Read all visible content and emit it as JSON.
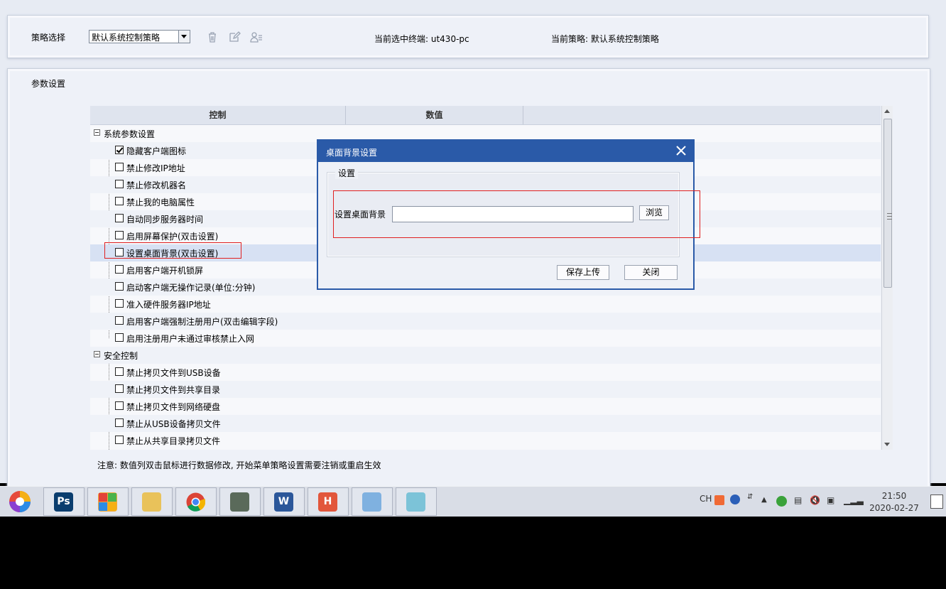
{
  "toolbar": {
    "strategy_label": "策略选择",
    "strategy_selected": "默认系统控制策略",
    "current_terminal": "当前选中终端: ut430-pc",
    "current_strategy": "当前策略: 默认系统控制策略"
  },
  "params": {
    "title": "参数设置",
    "columns": [
      "控制",
      "数值"
    ],
    "groups": [
      {
        "label": "系统参数设置",
        "items": [
          {
            "label": "隐藏客户端图标",
            "checked": true
          },
          {
            "label": "禁止修改IP地址",
            "checked": false
          },
          {
            "label": "禁止修改机器名",
            "checked": false
          },
          {
            "label": "禁止我的电脑属性",
            "checked": false
          },
          {
            "label": "自动同步服务器时间",
            "checked": false
          },
          {
            "label": "启用屏幕保护(双击设置)",
            "checked": false
          },
          {
            "label": "设置桌面背景(双击设置)",
            "checked": false
          },
          {
            "label": "启用客户端开机锁屏",
            "checked": false
          },
          {
            "label": "启动客户端无操作记录(单位:分钟)",
            "checked": false
          },
          {
            "label": "准入硬件服务器IP地址",
            "checked": false
          },
          {
            "label": "启用客户端强制注册用户(双击编辑字段)",
            "checked": false
          },
          {
            "label": "启用注册用户未通过审核禁止入网",
            "checked": false
          }
        ]
      },
      {
        "label": "安全控制",
        "items": [
          {
            "label": "禁止拷贝文件到USB设备",
            "checked": false
          },
          {
            "label": "禁止拷贝文件到共享目录",
            "checked": false
          },
          {
            "label": "禁止拷贝文件到网络硬盘",
            "checked": false
          },
          {
            "label": "禁止从USB设备拷贝文件",
            "checked": false
          },
          {
            "label": "禁止从共享目录拷贝文件",
            "checked": false
          }
        ]
      }
    ],
    "note": "注意: 数值列双击鼠标进行数据修改, 开始菜单策略设置需要注销或重启生效"
  },
  "dialog": {
    "title": "桌面背景设置",
    "group_label": "设置",
    "field_label": "设置桌面背景",
    "field_value": "",
    "browse_label": "浏览",
    "save_label": "保存上传",
    "close_label": "关闭"
  },
  "taskbar": {
    "apps": [
      "Ps",
      "W",
      "H"
    ],
    "ime": "CH",
    "time": "21:50",
    "date": "2020-02-27"
  },
  "colors": {
    "dialog_title": "#2a5aa8",
    "highlight_box": "#e02020",
    "selected_row": "#d7e1f3"
  }
}
